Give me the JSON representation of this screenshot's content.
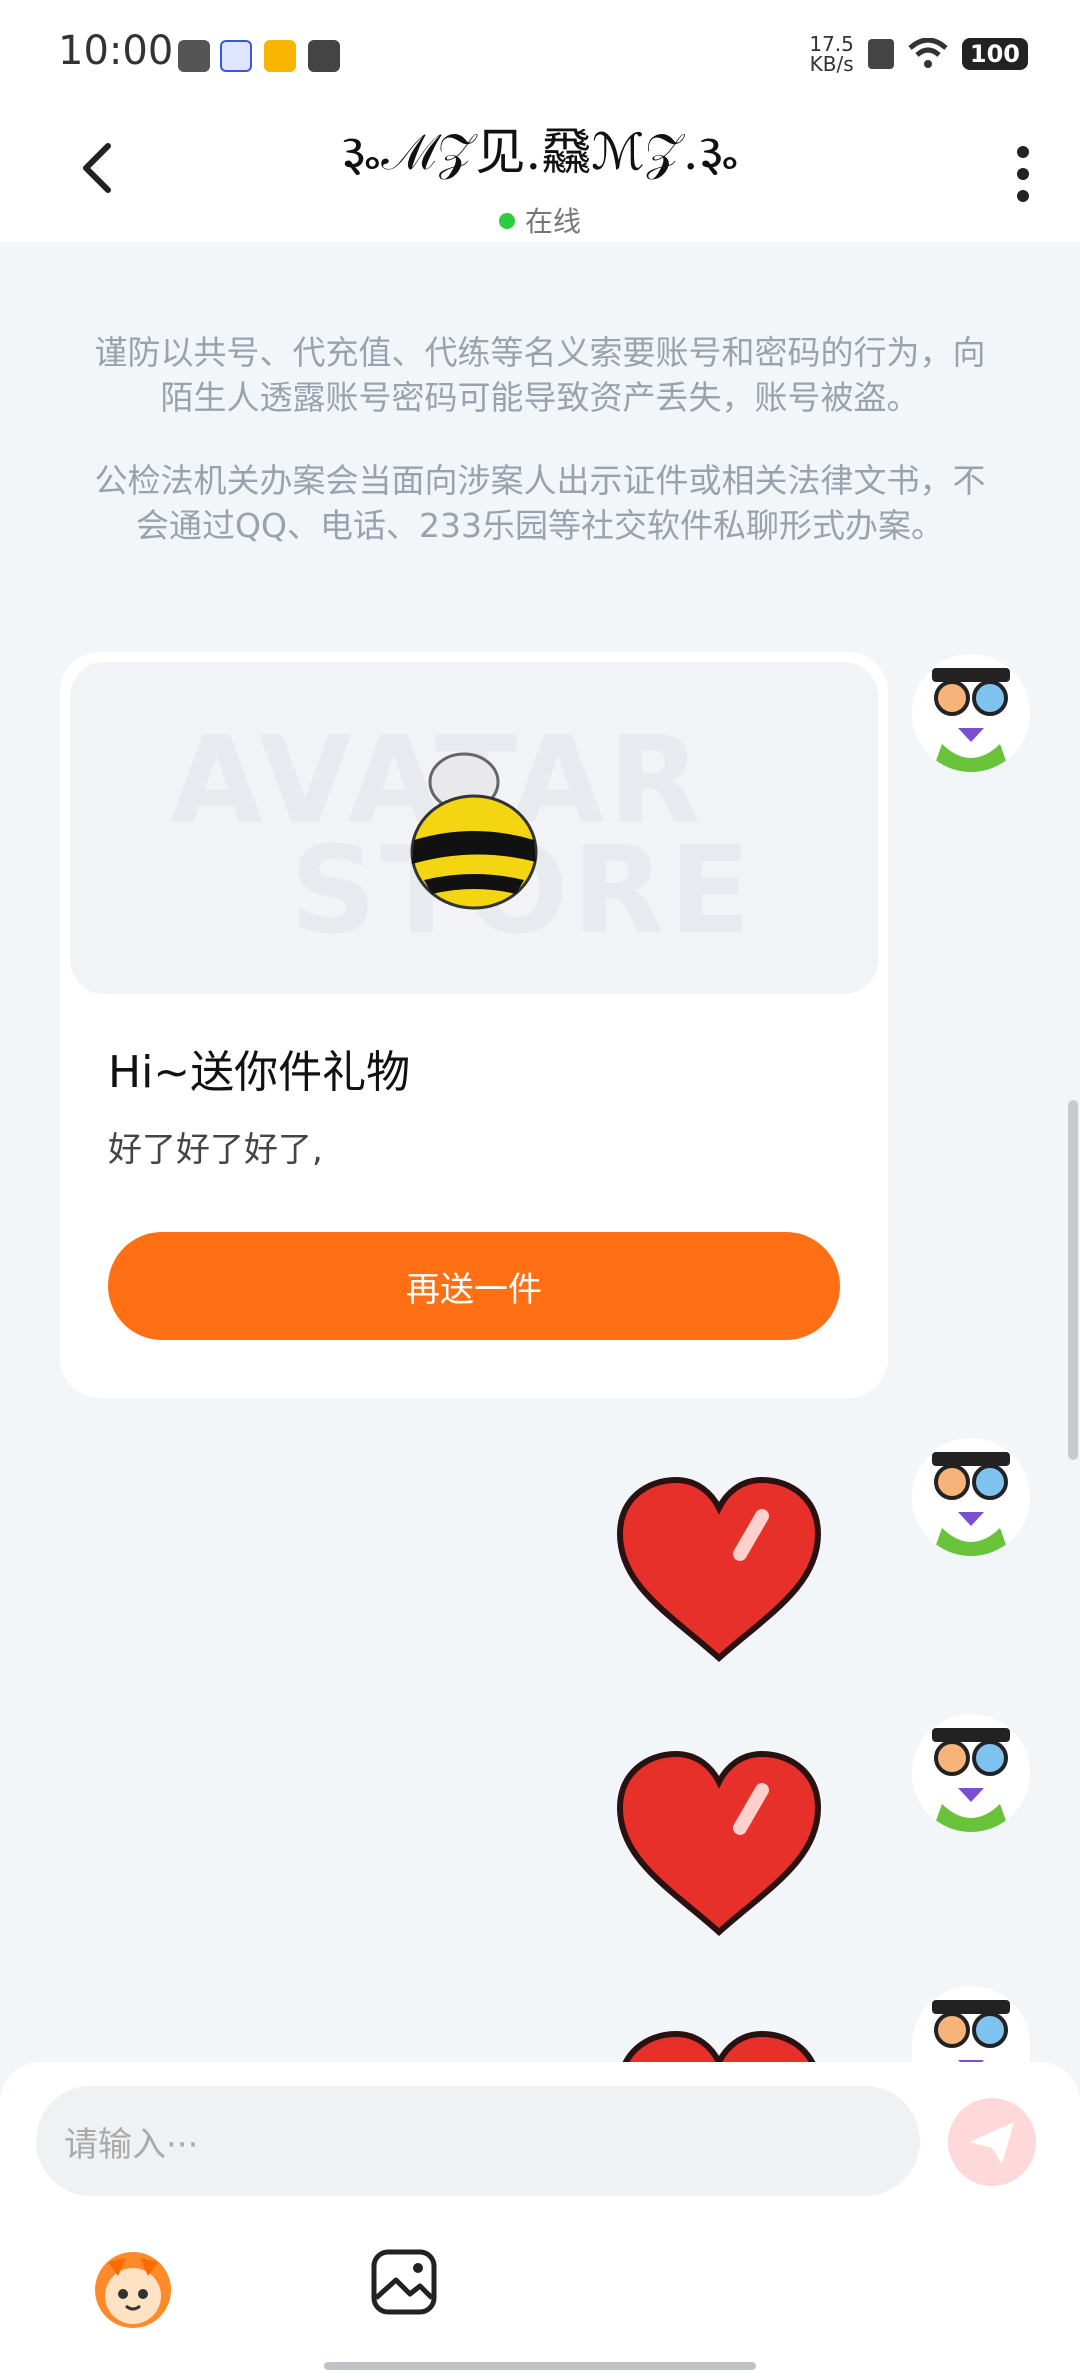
{
  "status_bar": {
    "time": "10:00",
    "net_speed_value": "17.5",
    "net_speed_unit": "KB/s",
    "battery": "100",
    "icons": [
      "clipboard-icon",
      "baidu-icon",
      "weibo-icon",
      "message-icon",
      "sim-icon",
      "wifi-icon",
      "battery-icon"
    ]
  },
  "header": {
    "title": "૱ℳ𝒵见.飝ℳ𝒵.૱",
    "status": "在线"
  },
  "notices": [
    "谨防以共号、代充值、代练等名义索要账号和密码的行为，向陌生人透露账号密码可能导致资产丢失，账号被盗。",
    "公检法机关办案会当面向涉案人出示证件或相关法律文书，不会通过QQ、电话、233乐园等社交软件私聊形式办案。"
  ],
  "gift_card": {
    "watermark_top": "AVATAR",
    "watermark_bottom": "STORE",
    "title": "Hi~送你件礼物",
    "message": "好了好了好了,",
    "button_label": "再送一件"
  },
  "messages": [
    {
      "type": "heart-emoji"
    },
    {
      "type": "heart-emoji"
    },
    {
      "type": "heart-emoji"
    }
  ],
  "input": {
    "placeholder": "请输入···"
  },
  "colors": {
    "accent": "#ff7014",
    "online": "#2ecc40",
    "background": "#f3f6f9"
  }
}
